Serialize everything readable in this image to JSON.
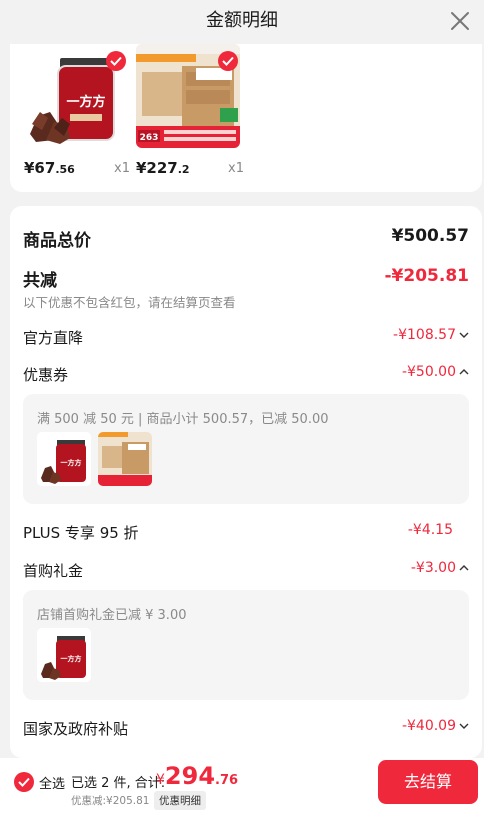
{
  "header": {
    "title": "金额明细",
    "close_icon": "close-icon"
  },
  "products": [
    {
      "price_int": "¥67",
      "price_dec": ".56",
      "qty": "x1",
      "brand_text": "一方方",
      "selected": true
    },
    {
      "price_int": "¥227",
      "price_dec": ".2",
      "qty": "x1",
      "badge": "263",
      "selected": true
    }
  ],
  "summary": {
    "total_label": "商品总价",
    "total_value": "¥500.57",
    "reduce_label": "共减",
    "reduce_value": "-¥205.81",
    "reduce_note": "以下优惠不包含红包，请在结算页查看",
    "official_label": "官方直降",
    "official_value": "-¥108.57",
    "coupon_label": "优惠券",
    "coupon_value": "-¥50.00",
    "coupon_detail": "满 500 减 50 元 | 商品小计 500.57，已减 50.00",
    "plus_label": "PLUS 专享 95 折",
    "plus_value": "-¥4.15",
    "first_label": "首购礼金",
    "first_value": "-¥3.00",
    "first_detail": "店铺首购礼金已减 ¥ 3.00",
    "subsidy_label": "国家及政府补贴",
    "subsidy_value": "-¥40.09"
  },
  "bottom": {
    "select_all": "全选",
    "selected_info": "已选 2 件, 合计:",
    "total_currency": "¥",
    "total_int": "294",
    "total_dec": ".76",
    "discount_info": "优惠减:¥205.81",
    "detail_label": "优惠明细",
    "checkout_label": "去结算"
  },
  "colors": {
    "accent": "#f0283c",
    "background": "#f2f2f2"
  }
}
